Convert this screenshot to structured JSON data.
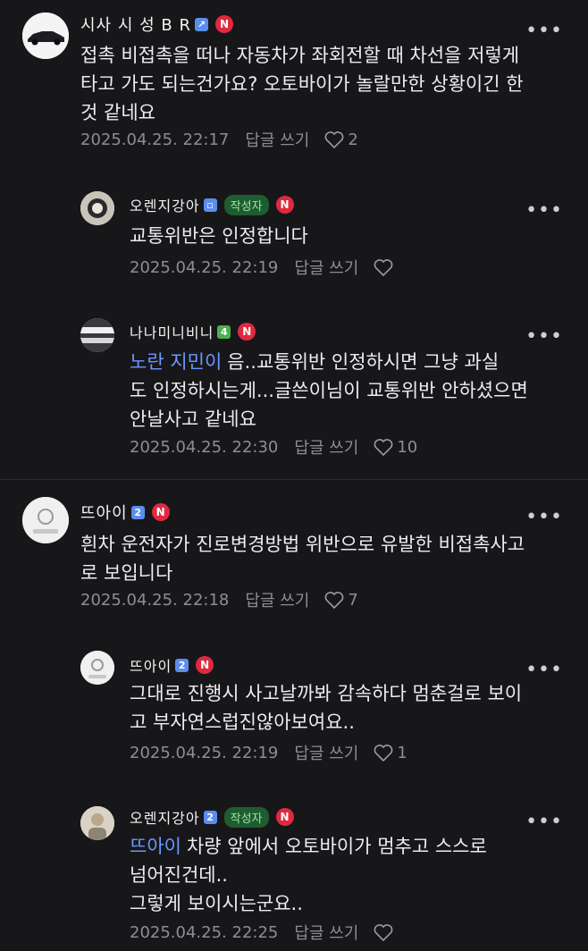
{
  "comments": [
    {
      "nickname": "시사 시 성 B R",
      "level": "",
      "badge": "N",
      "body": "접촉 비접촉을 떠나 자동차가 좌회전할 때 차선을 저렇게\n타고 가도 되는건가요? 오토바이가 놀랄만한 상황이긴 한\n것 같네요",
      "time": "2025.04.25. 22:17",
      "reply": "답글 쓰기",
      "likes": "2"
    },
    {
      "nickname": "오렌지강아",
      "level": "",
      "author_tag": "작성자",
      "badge": "N",
      "body": "교통위반은 인정합니다",
      "time": "2025.04.25. 22:19",
      "reply": "답글 쓰기",
      "likes": ""
    },
    {
      "nickname": "나나미니비니",
      "level": "4",
      "badge": "N",
      "mention": "노란 지민이",
      "body": "음..교통위반  인정하시면 그냥  과실\n도 인정하시는게...글쓴이님이 교통위반 안하셨으면\n안날사고 같네요",
      "time": "2025.04.25. 22:30",
      "reply": "답글 쓰기",
      "likes": "10"
    },
    {
      "nickname": "뜨아이",
      "level": "2",
      "badge": "N",
      "body": "흰차 운전자가 진로변경방법 위반으로 유발한 비접촉사고\n로 보입니다",
      "time": "2025.04.25. 22:18",
      "reply": "답글 쓰기",
      "likes": "7"
    },
    {
      "nickname": "뜨아이",
      "level": "2",
      "badge": "N",
      "body": "그대로 진행시 사고날까봐 감속하다 멈춘걸로 보이\n고 부자연스럽진않아보여요..",
      "time": "2025.04.25. 22:19",
      "reply": "답글 쓰기",
      "likes": "1"
    },
    {
      "nickname": "오렌지강아",
      "level": "2",
      "author_tag": "작성자",
      "badge": "N",
      "mention": "뜨아이",
      "body": "차량 앞에서 오토바이가 멈추고 스스로\n넘어진건데..\n그렇게 보이시는군요..",
      "time": "2025.04.25. 22:25",
      "reply": "답글 쓰기",
      "likes": ""
    }
  ],
  "colors": {
    "background": "#17171a",
    "badge_red": "#e0293f",
    "author_green": "#1e5d2f",
    "mention_blue": "#6b97ff"
  },
  "icons": [
    "more-icon",
    "heart-icon",
    "avatar-car",
    "avatar-user"
  ]
}
